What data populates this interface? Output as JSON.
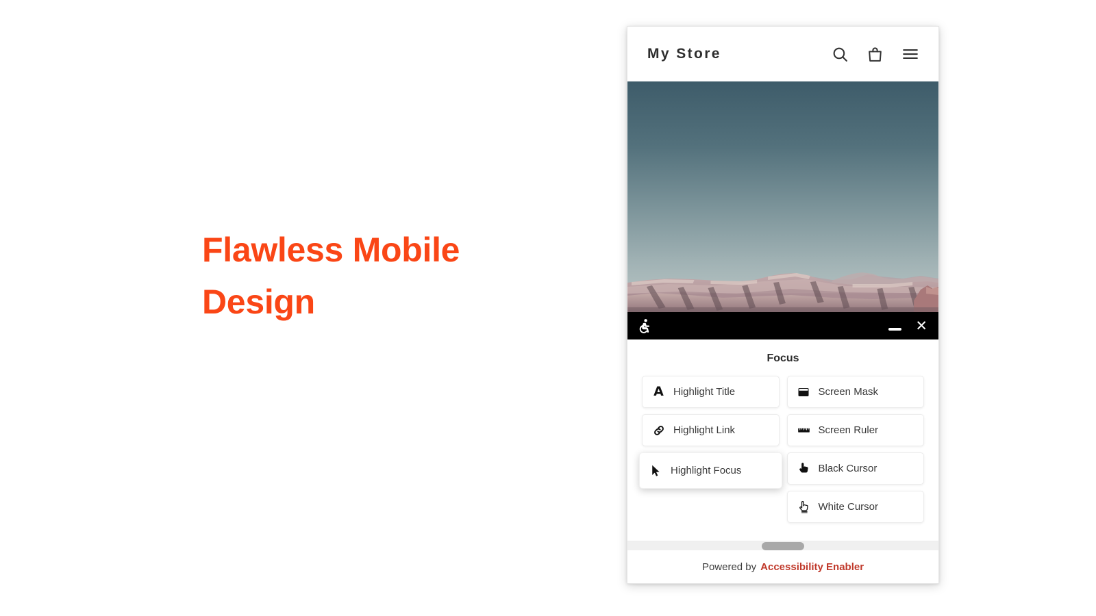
{
  "page": {
    "background": "#ffffff",
    "accent_orange": "#fa4616"
  },
  "marketing": {
    "headline": "Flawless Mobile Design"
  },
  "store": {
    "title": "My Store",
    "icons": [
      {
        "name": "search-icon",
        "label": "Search"
      },
      {
        "name": "shopping-bag-icon",
        "label": "Cart"
      },
      {
        "name": "hamburger-menu-icon",
        "label": "Menu"
      }
    ]
  },
  "hero": {
    "alt": "Canyon landscape with teal sky",
    "sky_top": "#3f5d6b",
    "sky_bottom": "#b8c4c4",
    "rock_color": "#b9999b"
  },
  "a11y_widget": {
    "logo_icon": "accessibility-wheelchair-icon",
    "bar_color": "#000000",
    "minimize_label": "Minimize",
    "close_label": "Close",
    "close_glyph": "✕",
    "panel_title": "Focus",
    "left_options": [
      {
        "icon": "letter-a-icon",
        "glyph": "A",
        "label": "Highlight Title",
        "active": false
      },
      {
        "icon": "link-chain-icon",
        "glyph": "",
        "label": "Highlight Link",
        "active": false
      },
      {
        "icon": "arrow-pointer-icon",
        "glyph": "",
        "label": "Highlight Focus",
        "active": true
      }
    ],
    "right_options": [
      {
        "icon": "screen-mask-icon",
        "glyph": "",
        "label": "Screen Mask",
        "active": false
      },
      {
        "icon": "ruler-icon",
        "glyph": "",
        "label": "Screen Ruler",
        "active": false
      },
      {
        "icon": "black-hand-cursor-icon",
        "glyph": "",
        "label": "Black Cursor",
        "active": false
      },
      {
        "icon": "white-hand-cursor-icon",
        "glyph": "",
        "label": "White Cursor",
        "active": false
      }
    ],
    "scrollbar": {
      "orientation": "horizontal",
      "thumb_color": "#a8a8a8",
      "track_color": "#f0f0f0"
    },
    "footer": {
      "prefix": "Powered by",
      "brand": "Accessibility Enabler",
      "brand_color": "#c0392b"
    }
  }
}
